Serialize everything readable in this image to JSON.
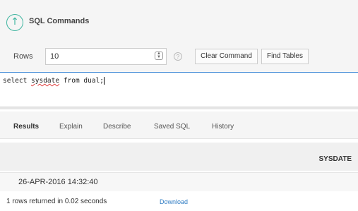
{
  "header": {
    "title": "SQL Commands",
    "icon": "up-arrow-icon",
    "accent": "#3fb5a0"
  },
  "toolbar": {
    "rows_label": "Rows",
    "rows_value": "10",
    "clear_label": "Clear Command",
    "find_label": "Find Tables"
  },
  "editor": {
    "pre": "select ",
    "keyword": "sysdate",
    "post": " from dual;"
  },
  "tabs": [
    {
      "label": "Results",
      "active": true
    },
    {
      "label": "Explain"
    },
    {
      "label": "Describe"
    },
    {
      "label": "Saved SQL"
    },
    {
      "label": "History"
    }
  ],
  "results": {
    "column": "SYSDATE",
    "rows": [
      "26-APR-2016 14:32:40"
    ],
    "status": "1 rows returned in 0.02 seconds",
    "download_label": "Download",
    "link_color": "#2f7cc3"
  }
}
